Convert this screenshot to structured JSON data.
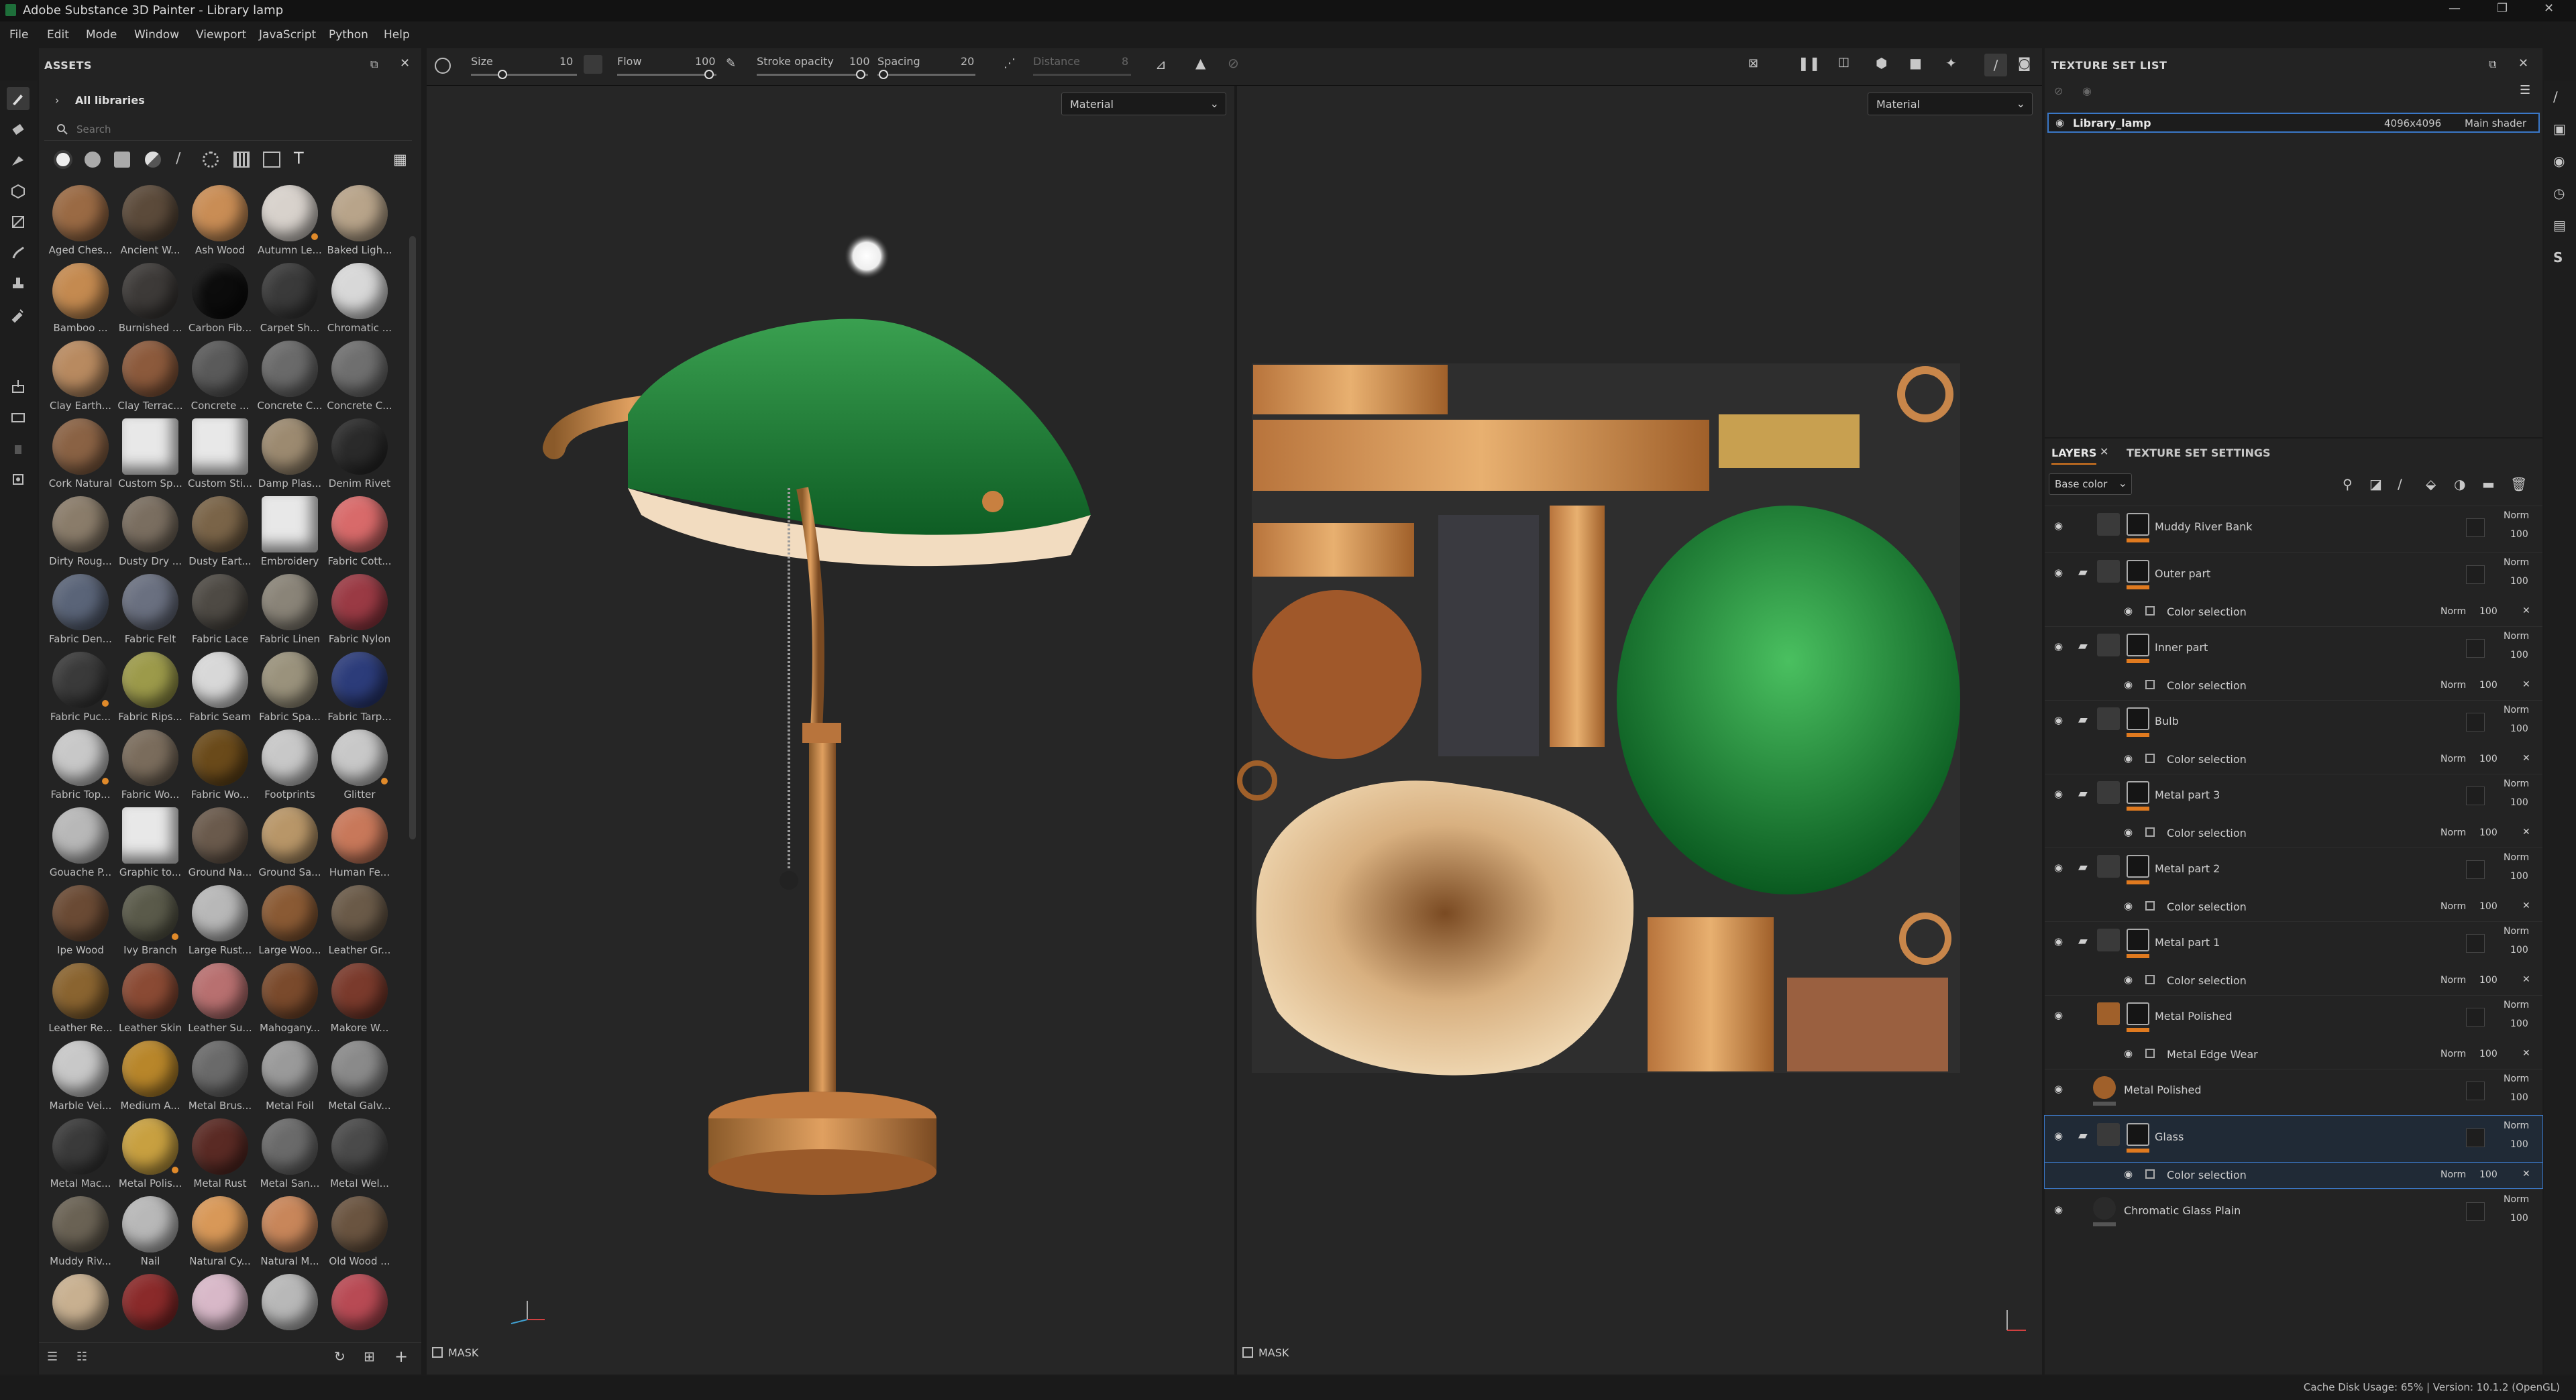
{
  "window": {
    "title": "Adobe Substance 3D Painter - Library lamp"
  },
  "menu": [
    "File",
    "Edit",
    "Mode",
    "Window",
    "Viewport",
    "JavaScript",
    "Python",
    "Help"
  ],
  "toolbar": {
    "size_label": "Size",
    "size_value": "10",
    "flow_label": "Flow",
    "flow_value": "100",
    "stroke_opacity_label": "Stroke opacity",
    "stroke_opacity_value": "100",
    "spacing_label": "Spacing",
    "spacing_value": "20",
    "distance_label": "Distance",
    "distance_value": "8"
  },
  "assets": {
    "title": "ASSETS",
    "library": "All libraries",
    "search_placeholder": "Search",
    "items": [
      "Aged Ches...",
      "Ancient W...",
      "Ash Wood",
      "Autumn Le...",
      "Baked Ligh...",
      "Bamboo ...",
      "Burnished ...",
      "Carbon Fib...",
      "Carpet Sh...",
      "Chromatic ...",
      "Clay Earth...",
      "Clay Terrac...",
      "Concrete ...",
      "Concrete C...",
      "Concrete C...",
      "Cork Natural",
      "Custom Sp...",
      "Custom Sti...",
      "Damp Plas...",
      "Denim Rivet",
      "Dirty Roug...",
      "Dusty Dry ...",
      "Dusty Eart...",
      "Embroidery",
      "Fabric Cott...",
      "Fabric Den...",
      "Fabric Felt",
      "Fabric Lace",
      "Fabric Linen",
      "Fabric Nylon",
      "Fabric Puc...",
      "Fabric Rips...",
      "Fabric Seam",
      "Fabric Spa...",
      "Fabric Tarp...",
      "Fabric Top...",
      "Fabric Wo...",
      "Fabric Wo...",
      "Footprints",
      "Glitter",
      "Gouache P...",
      "Graphic to...",
      "Ground Na...",
      "Ground Sa...",
      "Human Fe...",
      "Ipe Wood",
      "Ivy Branch",
      "Large Rust...",
      "Large Woo...",
      "Leather Gr...",
      "Leather Re...",
      "Leather Skin",
      "Leather Su...",
      "Mahogany...",
      "Makore W...",
      "Marble Vei...",
      "Medium A...",
      "Metal Brus...",
      "Metal Foil",
      "Metal Galv...",
      "Metal Mac...",
      "Metal Polis...",
      "Metal Rust",
      "Metal San...",
      "Metal Wel...",
      "Muddy Riv...",
      "Nail",
      "Natural Cy...",
      "Natural M...",
      "Old Wood ...",
      "",
      "",
      "",
      "",
      ""
    ],
    "colors": [
      "#9a6a44",
      "#5b4a3a",
      "#c98d55",
      "#d8d2cc",
      "#b8a48a",
      "#c48a50",
      "#3d3a38",
      "#0c0c0c",
      "#3a3a3a",
      "#d8d8d8",
      "#b88a60",
      "#8c5a3c",
      "#5a5a5a",
      "#6a6a6a",
      "#6f6f6f",
      "#8a6244",
      "#e8e8e8",
      "#e8e8e8",
      "#9c8a70",
      "#2a2a2a",
      "#8a7c6a",
      "#7a6e60",
      "#7a6448",
      "#e8e8e8",
      "#d86a6a",
      "#5a6478",
      "#6a7080",
      "#4e4a44",
      "#8a8478",
      "#9a3a44",
      "#3a3a3a",
      "#9c9a4a",
      "#d8d8d8",
      "#9a927c",
      "#2c3c7a",
      "#c8c8c8",
      "#7a6c5c",
      "#6a4a1a",
      "#c8c8c8",
      "#c8c8c8",
      "#b8b8b8",
      "#e8e8e8",
      "#6a5a4c",
      "#b89668",
      "#c8785a",
      "#6a4a34",
      "#5a5a4a",
      "#b8b8b8",
      "#8a5a34",
      "#6a5a48",
      "#8a6430",
      "#8a4a34",
      "#b87070",
      "#7a4a2c",
      "#7a3a2c",
      "#c8c8c8",
      "#b8862a",
      "#6a6a6a",
      "#9a9a9a",
      "#8a8a8a",
      "#3a3a3a",
      "#c8a040",
      "#5a2a24",
      "#6a6a6a",
      "#4a4a4a",
      "#6a6254",
      "#b8b8b8",
      "#d89858",
      "#c8865a",
      "#6a5440",
      "#c8b090",
      "#8a2a2a",
      "#d8b8c8",
      "#b8b8b8",
      "#b84a54"
    ]
  },
  "viewport_3d": {
    "mode": "Material",
    "mask_label": "MASK"
  },
  "viewport_2d": {
    "mode": "Material",
    "mask_label": "MASK"
  },
  "texture_set_list": {
    "title": "TEXTURE SET LIST",
    "name": "Library_lamp",
    "resolution": "4096x4096",
    "shader": "Main shader"
  },
  "layers_panel": {
    "tab_layers": "LAYERS",
    "tab_settings": "TEXTURE SET SETTINGS",
    "channel": "Base color",
    "rows": [
      {
        "name": "Muddy River Bank",
        "blend": "Norm",
        "opacity": "100",
        "type": "fill"
      },
      {
        "name": "Outer part",
        "blend": "Norm",
        "opacity": "100",
        "type": "folder"
      },
      {
        "name": "Color selection",
        "blend": "Norm",
        "opacity": "100",
        "type": "sub"
      },
      {
        "name": "Inner part",
        "blend": "Norm",
        "opacity": "100",
        "type": "folder"
      },
      {
        "name": "Color selection",
        "blend": "Norm",
        "opacity": "100",
        "type": "sub"
      },
      {
        "name": "Bulb",
        "blend": "Norm",
        "opacity": "100",
        "type": "folder"
      },
      {
        "name": "Color selection",
        "blend": "Norm",
        "opacity": "100",
        "type": "sub"
      },
      {
        "name": "Metal part 3",
        "blend": "Norm",
        "opacity": "100",
        "type": "folder"
      },
      {
        "name": "Color selection",
        "blend": "Norm",
        "opacity": "100",
        "type": "sub"
      },
      {
        "name": "Metal part 2",
        "blend": "Norm",
        "opacity": "100",
        "type": "folder"
      },
      {
        "name": "Color selection",
        "blend": "Norm",
        "opacity": "100",
        "type": "sub"
      },
      {
        "name": "Metal part 1",
        "blend": "Norm",
        "opacity": "100",
        "type": "folder"
      },
      {
        "name": "Color selection",
        "blend": "Norm",
        "opacity": "100",
        "type": "sub"
      },
      {
        "name": "Metal Polished",
        "blend": "Norm",
        "opacity": "100",
        "type": "fill"
      },
      {
        "name": "Metal Edge Wear",
        "blend": "Norm",
        "opacity": "100",
        "type": "sub"
      },
      {
        "name": "Metal Polished",
        "blend": "Norm",
        "opacity": "100",
        "type": "plain"
      },
      {
        "name": "Glass",
        "blend": "Norm",
        "opacity": "100",
        "type": "folder"
      },
      {
        "name": "Color selection",
        "blend": "Norm",
        "opacity": "100",
        "type": "sub"
      },
      {
        "name": "Chromatic Glass Plain",
        "blend": "Norm",
        "opacity": "100",
        "type": "plain"
      }
    ]
  },
  "status": {
    "text": "Cache Disk Usage:    65% | Version: 10.1.2 (OpenGL)"
  },
  "accent": "#e07a1f"
}
